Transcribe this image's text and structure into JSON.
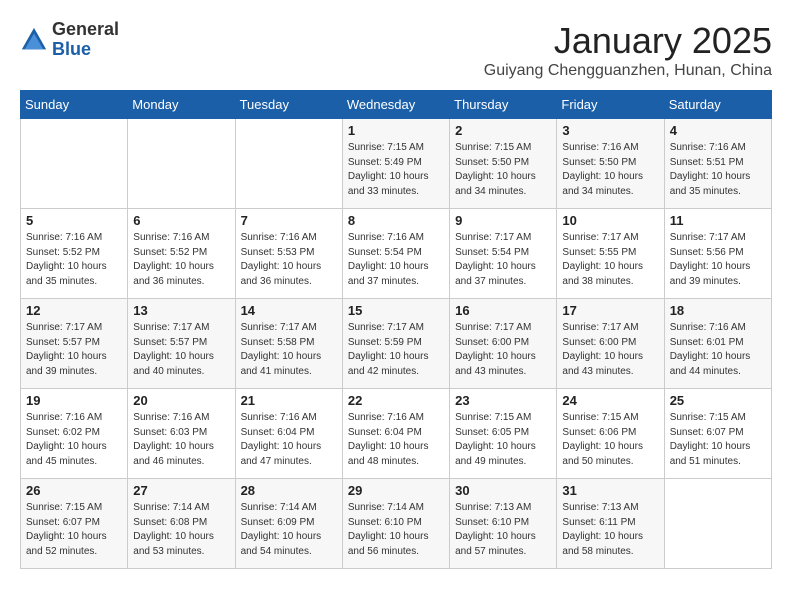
{
  "header": {
    "logo_general": "General",
    "logo_blue": "Blue",
    "month_title": "January 2025",
    "location": "Guiyang Chengguanzhen, Hunan, China"
  },
  "days_of_week": [
    "Sunday",
    "Monday",
    "Tuesday",
    "Wednesday",
    "Thursday",
    "Friday",
    "Saturday"
  ],
  "weeks": [
    {
      "days": [
        {
          "num": "",
          "info": ""
        },
        {
          "num": "",
          "info": ""
        },
        {
          "num": "",
          "info": ""
        },
        {
          "num": "1",
          "info": "Sunrise: 7:15 AM\nSunset: 5:49 PM\nDaylight: 10 hours\nand 33 minutes."
        },
        {
          "num": "2",
          "info": "Sunrise: 7:15 AM\nSunset: 5:50 PM\nDaylight: 10 hours\nand 34 minutes."
        },
        {
          "num": "3",
          "info": "Sunrise: 7:16 AM\nSunset: 5:50 PM\nDaylight: 10 hours\nand 34 minutes."
        },
        {
          "num": "4",
          "info": "Sunrise: 7:16 AM\nSunset: 5:51 PM\nDaylight: 10 hours\nand 35 minutes."
        }
      ]
    },
    {
      "days": [
        {
          "num": "5",
          "info": "Sunrise: 7:16 AM\nSunset: 5:52 PM\nDaylight: 10 hours\nand 35 minutes."
        },
        {
          "num": "6",
          "info": "Sunrise: 7:16 AM\nSunset: 5:52 PM\nDaylight: 10 hours\nand 36 minutes."
        },
        {
          "num": "7",
          "info": "Sunrise: 7:16 AM\nSunset: 5:53 PM\nDaylight: 10 hours\nand 36 minutes."
        },
        {
          "num": "8",
          "info": "Sunrise: 7:16 AM\nSunset: 5:54 PM\nDaylight: 10 hours\nand 37 minutes."
        },
        {
          "num": "9",
          "info": "Sunrise: 7:17 AM\nSunset: 5:54 PM\nDaylight: 10 hours\nand 37 minutes."
        },
        {
          "num": "10",
          "info": "Sunrise: 7:17 AM\nSunset: 5:55 PM\nDaylight: 10 hours\nand 38 minutes."
        },
        {
          "num": "11",
          "info": "Sunrise: 7:17 AM\nSunset: 5:56 PM\nDaylight: 10 hours\nand 39 minutes."
        }
      ]
    },
    {
      "days": [
        {
          "num": "12",
          "info": "Sunrise: 7:17 AM\nSunset: 5:57 PM\nDaylight: 10 hours\nand 39 minutes."
        },
        {
          "num": "13",
          "info": "Sunrise: 7:17 AM\nSunset: 5:57 PM\nDaylight: 10 hours\nand 40 minutes."
        },
        {
          "num": "14",
          "info": "Sunrise: 7:17 AM\nSunset: 5:58 PM\nDaylight: 10 hours\nand 41 minutes."
        },
        {
          "num": "15",
          "info": "Sunrise: 7:17 AM\nSunset: 5:59 PM\nDaylight: 10 hours\nand 42 minutes."
        },
        {
          "num": "16",
          "info": "Sunrise: 7:17 AM\nSunset: 6:00 PM\nDaylight: 10 hours\nand 43 minutes."
        },
        {
          "num": "17",
          "info": "Sunrise: 7:17 AM\nSunset: 6:00 PM\nDaylight: 10 hours\nand 43 minutes."
        },
        {
          "num": "18",
          "info": "Sunrise: 7:16 AM\nSunset: 6:01 PM\nDaylight: 10 hours\nand 44 minutes."
        }
      ]
    },
    {
      "days": [
        {
          "num": "19",
          "info": "Sunrise: 7:16 AM\nSunset: 6:02 PM\nDaylight: 10 hours\nand 45 minutes."
        },
        {
          "num": "20",
          "info": "Sunrise: 7:16 AM\nSunset: 6:03 PM\nDaylight: 10 hours\nand 46 minutes."
        },
        {
          "num": "21",
          "info": "Sunrise: 7:16 AM\nSunset: 6:04 PM\nDaylight: 10 hours\nand 47 minutes."
        },
        {
          "num": "22",
          "info": "Sunrise: 7:16 AM\nSunset: 6:04 PM\nDaylight: 10 hours\nand 48 minutes."
        },
        {
          "num": "23",
          "info": "Sunrise: 7:15 AM\nSunset: 6:05 PM\nDaylight: 10 hours\nand 49 minutes."
        },
        {
          "num": "24",
          "info": "Sunrise: 7:15 AM\nSunset: 6:06 PM\nDaylight: 10 hours\nand 50 minutes."
        },
        {
          "num": "25",
          "info": "Sunrise: 7:15 AM\nSunset: 6:07 PM\nDaylight: 10 hours\nand 51 minutes."
        }
      ]
    },
    {
      "days": [
        {
          "num": "26",
          "info": "Sunrise: 7:15 AM\nSunset: 6:07 PM\nDaylight: 10 hours\nand 52 minutes."
        },
        {
          "num": "27",
          "info": "Sunrise: 7:14 AM\nSunset: 6:08 PM\nDaylight: 10 hours\nand 53 minutes."
        },
        {
          "num": "28",
          "info": "Sunrise: 7:14 AM\nSunset: 6:09 PM\nDaylight: 10 hours\nand 54 minutes."
        },
        {
          "num": "29",
          "info": "Sunrise: 7:14 AM\nSunset: 6:10 PM\nDaylight: 10 hours\nand 56 minutes."
        },
        {
          "num": "30",
          "info": "Sunrise: 7:13 AM\nSunset: 6:10 PM\nDaylight: 10 hours\nand 57 minutes."
        },
        {
          "num": "31",
          "info": "Sunrise: 7:13 AM\nSunset: 6:11 PM\nDaylight: 10 hours\nand 58 minutes."
        },
        {
          "num": "",
          "info": ""
        }
      ]
    }
  ]
}
